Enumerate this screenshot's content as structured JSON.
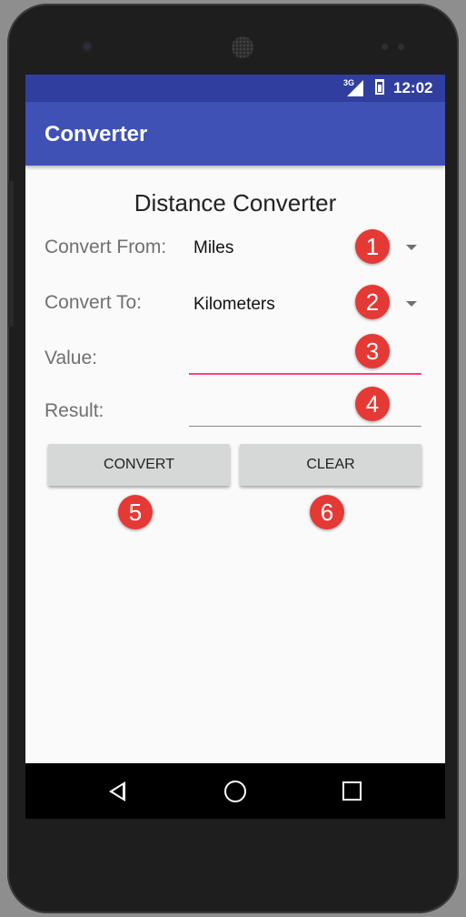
{
  "status_bar": {
    "network": "3G",
    "time": "12:02"
  },
  "app_bar": {
    "title": "Converter"
  },
  "main": {
    "heading": "Distance Converter",
    "convert_from": {
      "label": "Convert From:",
      "value": "Miles"
    },
    "convert_to": {
      "label": "Convert To:",
      "value": "Kilometers"
    },
    "value_field": {
      "label": "Value:",
      "value": ""
    },
    "result_field": {
      "label": "Result:",
      "value": ""
    },
    "buttons": {
      "convert": "CONVERT",
      "clear": "CLEAR"
    }
  },
  "annotations": [
    "1",
    "2",
    "3",
    "4",
    "5",
    "6"
  ],
  "colors": {
    "status_bar": "#303f9f",
    "app_bar": "#3f51b5",
    "accent": "#ff4081",
    "badge": "#e53935",
    "button": "#d6d7d7"
  },
  "icons": [
    "camera-icon",
    "speaker-icon",
    "signal-icon",
    "battery-icon",
    "dropdown-arrow-icon",
    "nav-back-icon",
    "nav-home-icon",
    "nav-recent-icon"
  ]
}
